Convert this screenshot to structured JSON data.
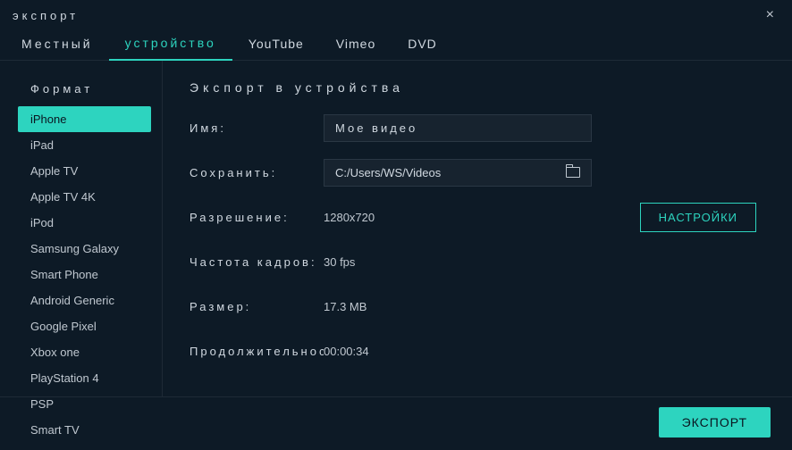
{
  "window": {
    "title": "экспорт"
  },
  "tabs": {
    "local": "Местный",
    "device": "устройство",
    "youtube": "YouTube",
    "vimeo": "Vimeo",
    "dvd": "DVD"
  },
  "sidebar": {
    "heading": "Формат",
    "items": [
      "iPhone",
      "iPad",
      "Apple TV",
      "Apple TV 4K",
      "iPod",
      "Samsung Galaxy",
      "Smart Phone",
      "Android Generic",
      "Google Pixel",
      "Xbox one",
      "PlayStation 4",
      "PSP",
      "Smart TV"
    ]
  },
  "main": {
    "heading": "Экспорт в устройства",
    "labels": {
      "name": "Имя:",
      "save_to": "Сохранить:",
      "resolution": "Разрешение:",
      "framerate": "Частота кадров:",
      "size": "Размер:",
      "duration": "Продолжительность:"
    },
    "values": {
      "name": "Мое видео",
      "save_to": "C:/Users/WS/Videos",
      "resolution": "1280x720",
      "framerate": "30 fps",
      "size": "17.3 MB",
      "duration": "00:00:34"
    },
    "settings_button": "НАСТРОЙКИ"
  },
  "footer": {
    "export_button": "ЭКСПОРТ"
  }
}
